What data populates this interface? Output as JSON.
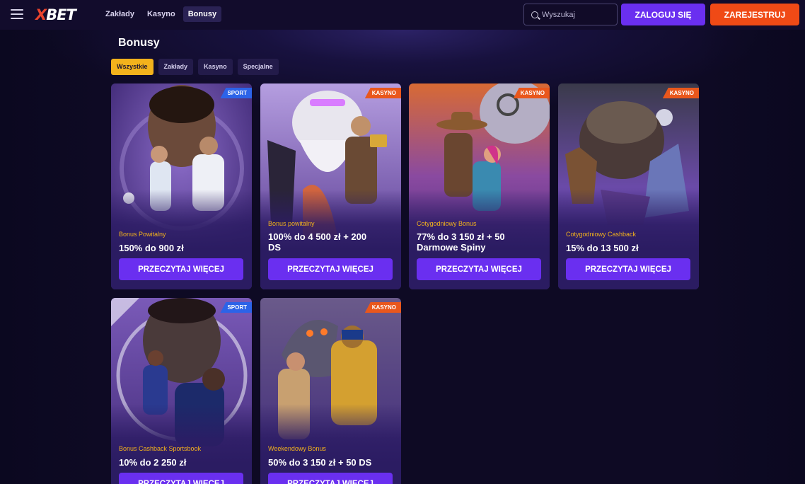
{
  "header": {
    "logo_x": "X",
    "logo_rest": "BET",
    "nav": [
      "Zakłady",
      "Kasyno",
      "Bonusy"
    ],
    "search_placeholder": "Wyszukaj",
    "login_label": "ZALOGUJ SIĘ",
    "register_label": "ZAREJESTRUJ"
  },
  "page": {
    "title": "Bonusy",
    "filters": [
      "Wszystkie",
      "Zakłady",
      "Kasyno",
      "Specjalne"
    ]
  },
  "cards": [
    {
      "tag": "SPORT",
      "subtitle": "Bonus Powitalny",
      "offer": "150% do 900 zł",
      "cta": "PRZECZYTAJ WIĘCEJ"
    },
    {
      "tag": "KASYNO",
      "subtitle": "Bonus powitalny",
      "offer": "100% do 4 500 zł + 200 DS",
      "cta": "PRZECZYTAJ WIĘCEJ"
    },
    {
      "tag": "KASYNO",
      "subtitle": "Cotygodniowy Bonus",
      "offer": "77% do 3 150 zł + 50 Darmowe Spiny",
      "cta": "PRZECZYTAJ WIĘCEJ"
    },
    {
      "tag": "KASYNO",
      "subtitle": "Cotygodniowy Cashback",
      "offer": "15% do 13 500 zł",
      "cta": "PRZECZYTAJ WIĘCEJ"
    },
    {
      "tag": "SPORT",
      "subtitle": "Bonus Cashback Sportsbook",
      "offer": "10% do 2 250 zł",
      "cta": "PRZECZYTAJ WIĘCEJ"
    },
    {
      "tag": "KASYNO",
      "subtitle": "Weekendowy Bonus",
      "offer": "50% do 3 150 zł + 50 DS",
      "cta": "PRZECZYTAJ WIĘCEJ"
    }
  ],
  "colors": {
    "accent": "#6a2ff0",
    "register": "#f04a16",
    "active_filter": "#f3b21c",
    "sport_tag": "#2c63e8",
    "casino_tag": "#e9571c"
  },
  "icons": [
    "menu-icon",
    "search-icon"
  ]
}
